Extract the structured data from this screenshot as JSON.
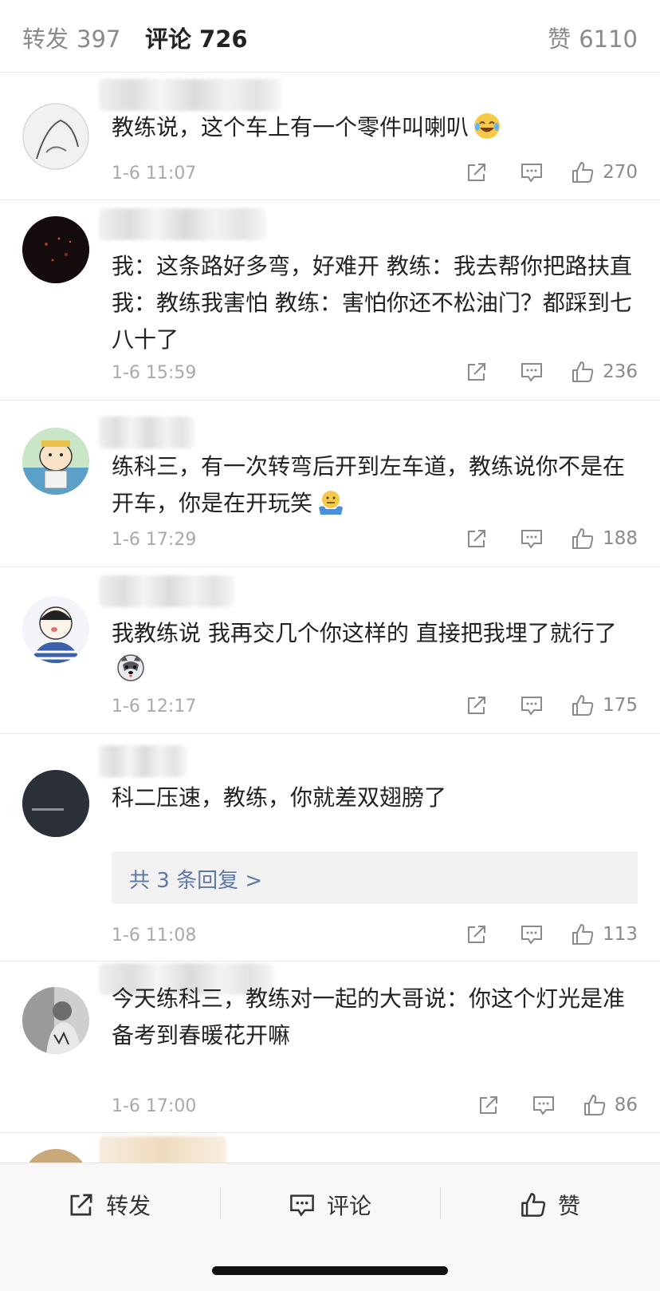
{
  "header": {
    "repost_label": "转发",
    "repost_count": "397",
    "comments_label": "评论",
    "comments_count": "726",
    "likes_label": "赞",
    "likes_count": "6110"
  },
  "comments": [
    {
      "text": "教练说，这个车上有一个零件叫喇叭",
      "emoji": "laughing-crying-emoji",
      "time": "1-6 11:07",
      "likes": "270"
    },
    {
      "text": "我：这条路好多弯，好难开 教练：我去帮你把路扶直 我：教练我害怕 教练：害怕你还不松油门？都踩到七八十了",
      "time": "1-6 15:59",
      "likes": "236"
    },
    {
      "text": "练科三，有一次转弯后开到左车道，教练说你不是在开车，你是在开玩笑",
      "emoji": "shrug-emoji",
      "time": "1-6 17:29",
      "likes": "188"
    },
    {
      "text": "我教练说 我再交几个你这样的 直接把我埋了就行了",
      "emoji": "husky-emoji",
      "time": "1-6 12:17",
      "likes": "175"
    },
    {
      "text": "科二压速，教练，你就差双翅膀了",
      "replies": "共 3 条回复 >",
      "time": "1-6 11:08",
      "likes": "113"
    },
    {
      "text": "今天练科三，教练对一起的大哥说：你这个灯光是准备考到春暖花开嘛",
      "time": "1-6 17:00",
      "likes": "86"
    }
  ],
  "bottom_bar": {
    "repost": "转发",
    "comment": "评论",
    "like": "赞"
  },
  "colors": {
    "link": "#5c79a6",
    "meta": "#a9a9a9",
    "icon": "#8a8a8a"
  }
}
